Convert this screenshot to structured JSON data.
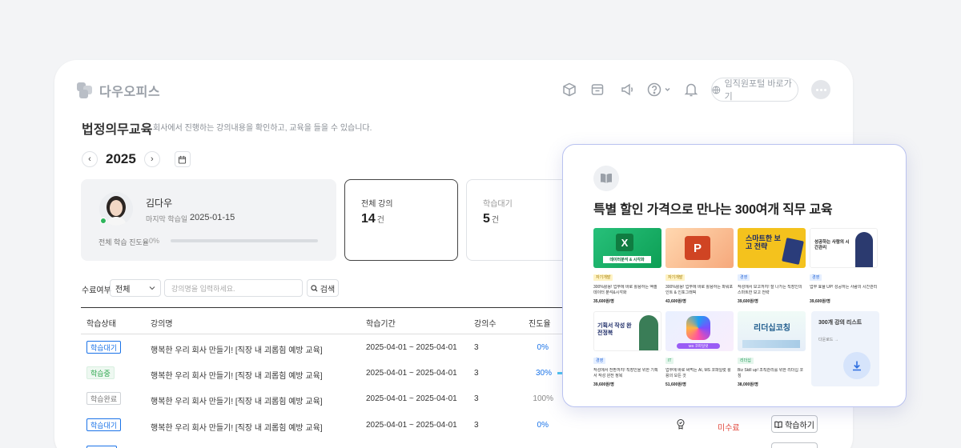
{
  "header": {
    "logo_text": "다우오피스",
    "icons": [
      "cube-icon",
      "store-icon",
      "megaphone-icon",
      "help-icon",
      "bell-icon"
    ],
    "portal_button": "임직원포털 바로가기"
  },
  "page": {
    "title": "법정의무교육",
    "description": "회사에서 진행하는 강의내용을 확인하고, 교육을 들을 수 있습니다.",
    "year": "2025"
  },
  "profile": {
    "name": "김다우",
    "last_label": "마지막 학습일",
    "last_date": "2025-01-15",
    "progress_label": "전체 학습 진도율",
    "progress_value": "0%",
    "progress_fraction": 0
  },
  "stats": [
    {
      "label": "전체 강의",
      "value": "14",
      "unit": "건"
    },
    {
      "label": "학습대기",
      "value": "5",
      "unit": "건"
    }
  ],
  "filter": {
    "label": "수료여부",
    "select_value": "전체",
    "input_placeholder": "강의명을 입력하세요.",
    "search_label": "검색"
  },
  "table": {
    "headers": [
      "학습상태",
      "강의명",
      "학습기간",
      "강의수",
      "진도율"
    ],
    "rows": [
      {
        "status": "학습대기",
        "title": "행복한 우리 회사 만들기! [직장 내 괴롭힘 예방 교육]",
        "period": "2025-04-01 ~ 2025-04-01",
        "count": "3",
        "progress": "0%"
      },
      {
        "status": "학습중",
        "title": "행복한 우리 회사 만들기! [직장 내 괴롭힘 예방 교육]",
        "period": "2025-04-01 ~ 2025-04-01",
        "count": "3",
        "progress": "30%"
      },
      {
        "status": "학습완료",
        "title": "행복한 우리 회사 만들기! [직장 내 괴롭힘 예방 교육]",
        "period": "2025-04-01 ~ 2025-04-01",
        "count": "3",
        "progress": "100%"
      },
      {
        "status": "학습대기",
        "title": "행복한 우리 회사 만들기! [직장 내 괴롭힘 예방 교육]",
        "period": "2025-04-01 ~ 2025-04-01",
        "count": "3",
        "progress": "0%",
        "completion": "미수료",
        "action": "학습하기"
      }
    ]
  },
  "promo": {
    "title": "특별 할인 가격으로 만나는 300여개 직무 교육",
    "courses": [
      {
        "thumb_text": "데이터분석 & 시각화",
        "tag": "자기개발",
        "title": "300%활용! 업무에 바로 활용하는 엑셀 데이터 분석&시각화",
        "price": "35,600원/명"
      },
      {
        "thumb_text": "",
        "tag": "자기개발",
        "title": "300%활용! 업무에 바로 활용하는 파워포인트 & 인포그래픽",
        "price": "43,600원/명"
      },
      {
        "thumb_text": "스마트한 보고 전략",
        "tag": "경영",
        "title": "작성에서 보고까지! 잘 나가는 직장인의 스마트한 보고 전략",
        "price": "39,600원/명"
      },
      {
        "thumb_text": "성공하는 사람의 시간관리",
        "tag": "경영",
        "title": "업무 효율 UP! 성공하는 사람의 시간관리",
        "price": "39,600원/명"
      },
      {
        "thumb_text": "기획서 작성 완전정복",
        "tag": "경영",
        "title": "작성에서 전환까지! 직장인을 위한 기획서 작성 완전 정복",
        "price": "39,600원/명"
      },
      {
        "thumb_text": "MS 코파일럿",
        "tag": "IT",
        "title": "업무에 바로 써먹는 AI, MS 코파일럿 활용의 모든 것",
        "price": "51,600원/명"
      },
      {
        "thumb_text": "리더십코칭",
        "tag": "리더십",
        "title": "Biz Skill up! 조직관리를 위한 리더십 코칭",
        "price": "38,000원/명"
      }
    ],
    "more_title": "300개 강의 리스트",
    "more_link": "다운로드 →"
  },
  "colors": {
    "accent": "#1a73e8",
    "green": "#2fa84f",
    "red": "#e2483d",
    "promo_border": "#b9c2f0"
  }
}
